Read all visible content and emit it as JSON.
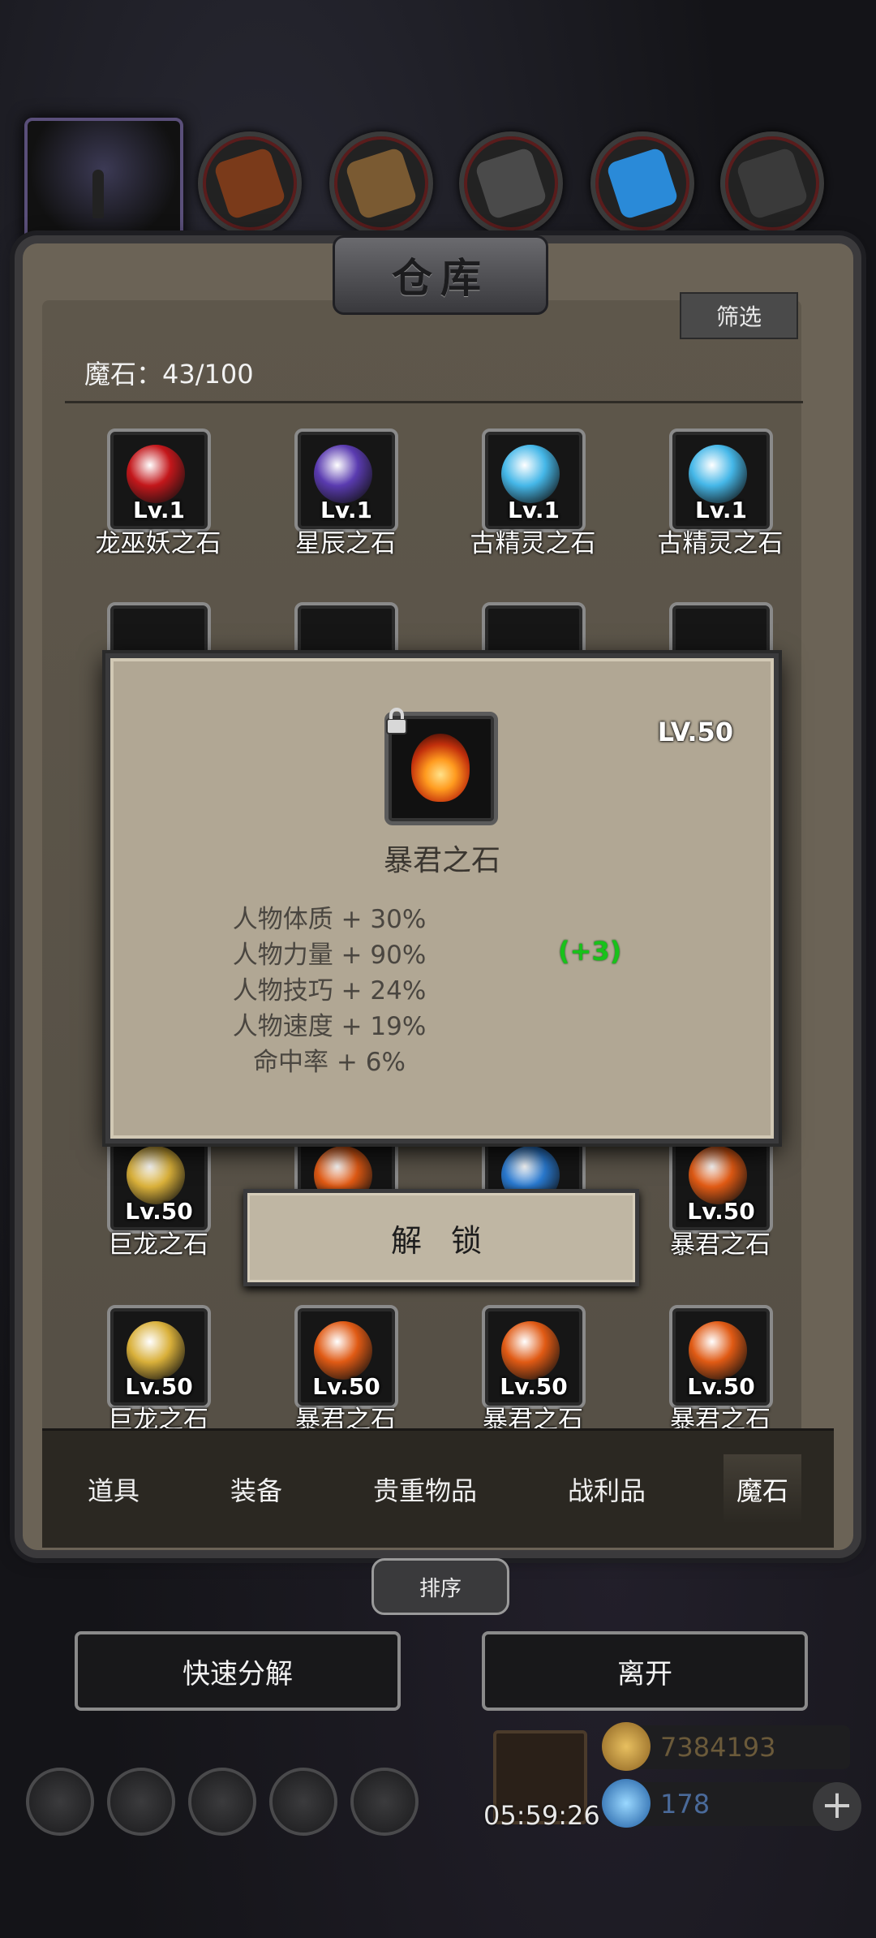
{
  "materials": [
    {
      "icon": "leather-material-icon",
      "color": "#7a3a1a"
    },
    {
      "icon": "wood-material-icon",
      "color": "#7a5a32"
    },
    {
      "icon": "iron-material-icon",
      "color": "#4a4a4a"
    },
    {
      "icon": "crystal-material-icon",
      "color": "#2a8ad8"
    },
    {
      "icon": "ore-material-icon",
      "color": "#3a3a3a"
    }
  ],
  "panel": {
    "title": "仓库",
    "filter_label": "筛选",
    "count_label": "魔石：43/100"
  },
  "items": [
    {
      "name": "龙巫妖之石",
      "level": "Lv.1",
      "color": "#c3171b"
    },
    {
      "name": "星辰之石",
      "level": "Lv.1",
      "color": "#5a3bb0"
    },
    {
      "name": "古精灵之石",
      "level": "Lv.1",
      "color": "#45b7e8"
    },
    {
      "name": "古精灵之石",
      "level": "Lv.1",
      "color": "#45b7e8"
    },
    {
      "name": "巨龙之石",
      "level": "Lv.50",
      "color": "#d9b03a"
    },
    {
      "name": "",
      "level": "",
      "color": "#e05a14"
    },
    {
      "name": "",
      "level": "",
      "color": "#2a7ad0"
    },
    {
      "name": "暴君之石",
      "level": "Lv.50",
      "color": "#e05a14"
    },
    {
      "name": "巨龙之石",
      "level": "Lv.50",
      "color": "#d9b03a"
    },
    {
      "name": "暴君之石",
      "level": "Lv.50",
      "color": "#e05a14"
    },
    {
      "name": "暴君之石",
      "level": "Lv.50",
      "color": "#e05a14"
    },
    {
      "name": "暴君之石",
      "level": "Lv.50",
      "color": "#e05a14"
    }
  ],
  "popup": {
    "level": "LV.50",
    "name": "暴君之石",
    "stats": [
      "人物体质 + 30%",
      "人物力量 + 90%",
      "人物技巧 + 24%",
      "人物速度 + 19%",
      "命中率 + 6%"
    ],
    "bonus": "(+3)",
    "unlock_label": "解 锁"
  },
  "tabs": [
    "道具",
    "装备",
    "贵重物品",
    "战利品",
    "魔石"
  ],
  "active_tab": "魔石",
  "sort_label": "排序",
  "quick_decompose_label": "快速分解",
  "leave_label": "离开",
  "timer": "05:59:26",
  "gold": "7384193",
  "gems": "178"
}
